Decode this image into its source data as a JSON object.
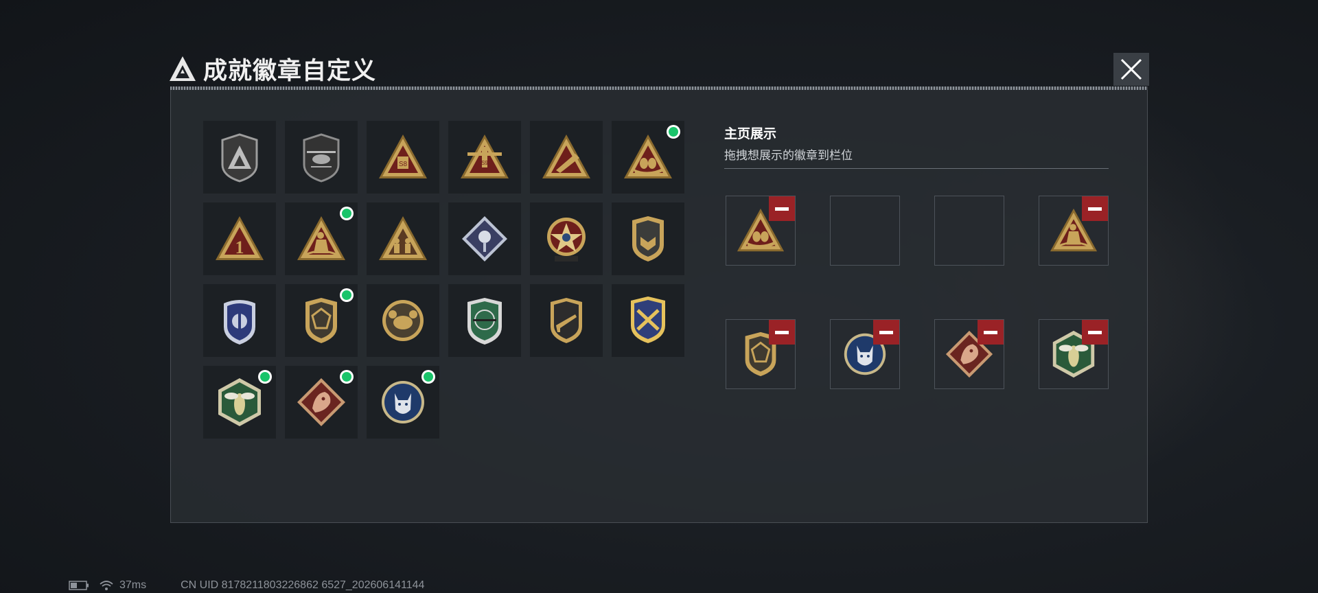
{
  "window": {
    "title": "成就徽章自定义"
  },
  "header": {
    "logo_icon": "delta-triangle-logo-icon",
    "close_icon": "close-icon"
  },
  "badges": [
    {
      "icon": "delta-shield-badge-icon",
      "new": false
    },
    {
      "icon": "helicopter-shield-badge-icon",
      "new": false
    },
    {
      "icon": "s8-triangle-badge-icon",
      "new": false
    },
    {
      "icon": "s9-aircraft-triangle-badge-icon",
      "new": false
    },
    {
      "icon": "rocket-pod-triangle-badge-icon",
      "new": false
    },
    {
      "icon": "eggs-nest-triangle-badge-icon",
      "new": true
    },
    {
      "icon": "number-one-triangle-badge-icon",
      "new": false
    },
    {
      "icon": "kneeling-soldier-triangle-badge-icon",
      "new": true
    },
    {
      "icon": "soldiers-triangle-badge-icon",
      "new": false
    },
    {
      "icon": "rose-diamond-badge-icon",
      "new": false
    },
    {
      "icon": "star-medal-badge-icon",
      "new": false
    },
    {
      "icon": "wings-shield-badge-icon",
      "new": false
    },
    {
      "icon": "blue-police-shield-badge-icon",
      "new": false
    },
    {
      "icon": "gem-shield-badge-icon",
      "new": true
    },
    {
      "icon": "crab-round-badge-icon",
      "new": false
    },
    {
      "icon": "rifle-crosshair-green-shield-icon",
      "new": false
    },
    {
      "icon": "rifle-shield-badge-icon",
      "new": false
    },
    {
      "icon": "crossed-rifles-gold-badge-icon",
      "new": false
    },
    {
      "icon": "wasp-hexagon-badge-icon",
      "new": true
    },
    {
      "icon": "dragon-diamond-badge-icon",
      "new": true
    },
    {
      "icon": "lynx-round-badge-icon",
      "new": true
    }
  ],
  "showcase": {
    "title": "主页展示",
    "subtitle": "拖拽想展示的徽章到栏位",
    "slots": [
      {
        "icon": "eggs-nest-triangle-badge-icon",
        "filled": true
      },
      {
        "icon": "",
        "filled": false
      },
      {
        "icon": "",
        "filled": false
      },
      {
        "icon": "kneeling-soldier-triangle-badge-icon",
        "filled": true
      },
      {
        "icon": "gem-shield-badge-icon",
        "filled": true
      },
      {
        "icon": "lynx-round-badge-icon",
        "filled": true
      },
      {
        "icon": "dragon-diamond-badge-icon",
        "filled": true
      },
      {
        "icon": "wasp-hexagon-badge-icon",
        "filled": true
      }
    ],
    "remove_icon": "minus-icon"
  },
  "colors": {
    "new_dot": "#19c46a",
    "remove": "#9a2226",
    "gold": "#c8a45a"
  },
  "status_bar": {
    "ping": "37ms",
    "uid": "CN UID 8178211803226862 6527_202606141144"
  }
}
